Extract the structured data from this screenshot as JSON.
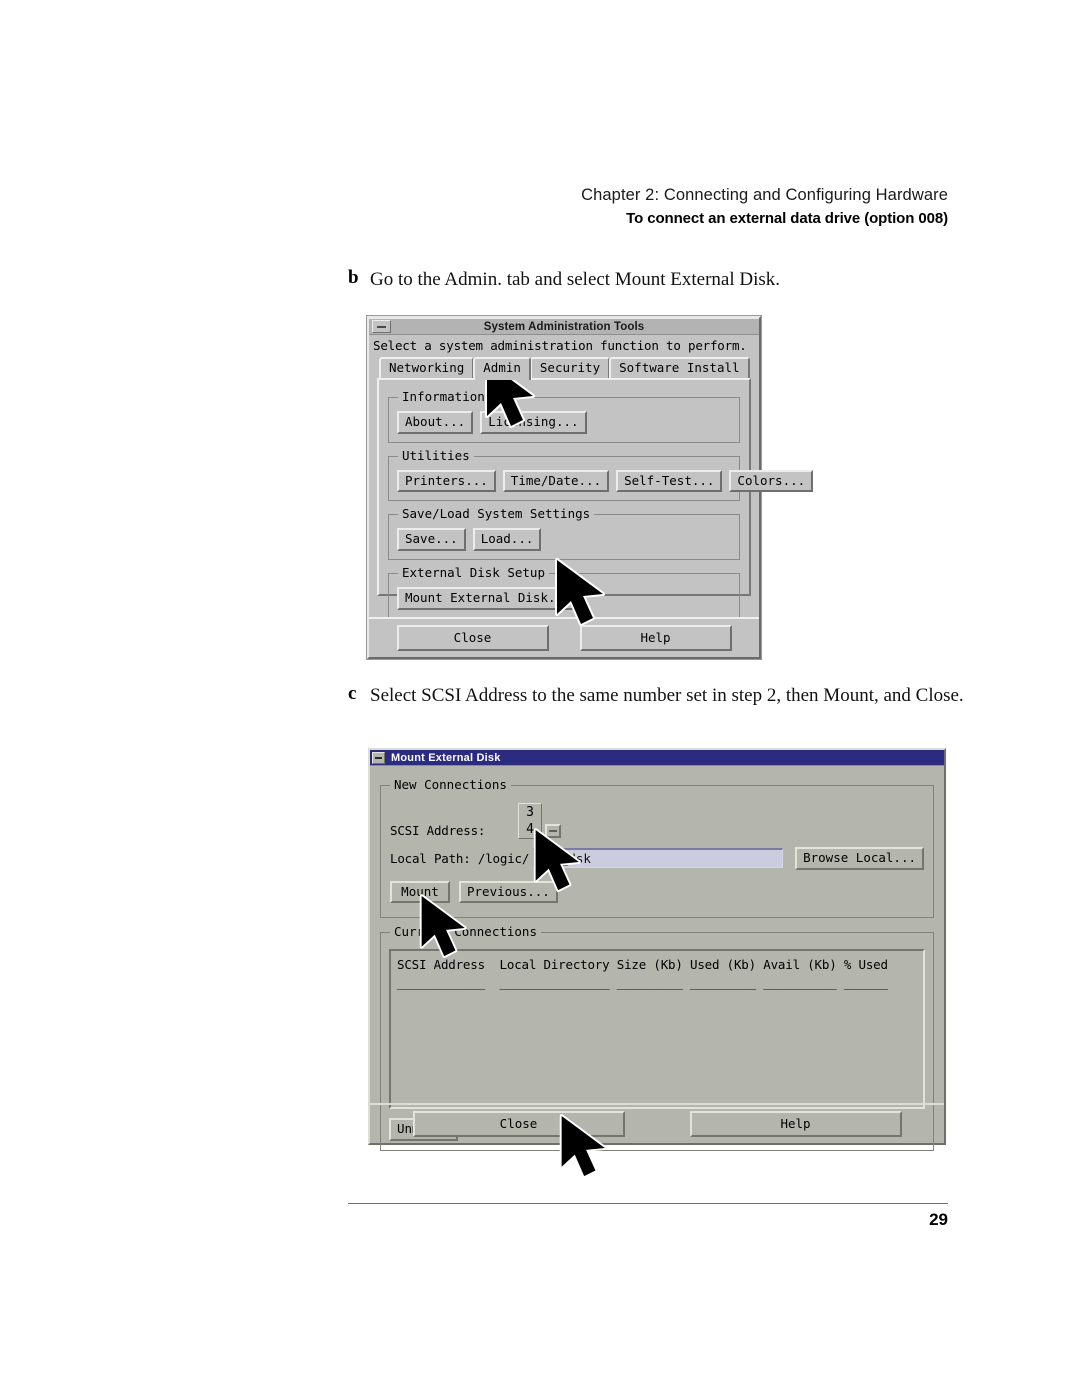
{
  "page": {
    "chapter_header": "Chapter 2: Connecting and Configuring Hardware",
    "section_header": "To connect an external data drive (option 008)",
    "page_number": "29"
  },
  "steps": [
    {
      "letter": "b",
      "text": "Go to the Admin. tab and select Mount External Disk."
    },
    {
      "letter": "c",
      "text": "Select SCSI Address to the same number set in step 2, then Mount, and Close."
    }
  ],
  "dialog_sat": {
    "title": "System Administration Tools",
    "prompt": "Select a system administration function to perform.",
    "tabs": [
      {
        "label": "Networking",
        "active": false
      },
      {
        "label": "Admin",
        "active": true
      },
      {
        "label": "Security",
        "active": false
      },
      {
        "label": "Software Install",
        "active": false
      }
    ],
    "groups": [
      {
        "legend": "Information",
        "buttons": [
          "About...",
          "Licensing..."
        ]
      },
      {
        "legend": "Utilities",
        "buttons": [
          "Printers...",
          "Time/Date...",
          "Self-Test...",
          "Colors..."
        ]
      },
      {
        "legend": "Save/Load System Settings",
        "buttons": [
          "Save...",
          "Load..."
        ]
      },
      {
        "legend": "External Disk Setup",
        "buttons": [
          "Mount External Disk..."
        ]
      }
    ],
    "footer_buttons": [
      "Close",
      "Help"
    ],
    "colors": {
      "face": "#c3c3c3",
      "titlebar": "#b3b3b3"
    }
  },
  "dialog_med": {
    "title": "Mount External Disk",
    "new_connections": {
      "legend": "New Connections",
      "scsi_label": "SCSI Address:",
      "scsi_prev_value": "3",
      "scsi_value": "4",
      "path_label": "Local Path: /logic/",
      "path_value": "ext_dsk",
      "browse_button": "Browse Local...",
      "mount_button": "Mount",
      "previous_button": "Previous..."
    },
    "current_connections": {
      "legend": "Current Connections",
      "columns": [
        "SCSI Address",
        "Local Directory",
        "Size (Kb)",
        "Used (Kb)",
        "Avail (Kb)",
        "% Used"
      ],
      "header_line": "SCSI Address  Local Directory Size (Kb) Used (Kb) Avail (Kb) % Used",
      "rule_line": "____________  _______________ _________ _________ __________ ______",
      "rows": [],
      "unmount_button": "Unmount"
    },
    "footer_buttons": [
      "Close",
      "Help"
    ],
    "colors": {
      "face": "#b4b6ad",
      "titlebar": "#2b2b80",
      "input": "#ccccdf"
    }
  }
}
